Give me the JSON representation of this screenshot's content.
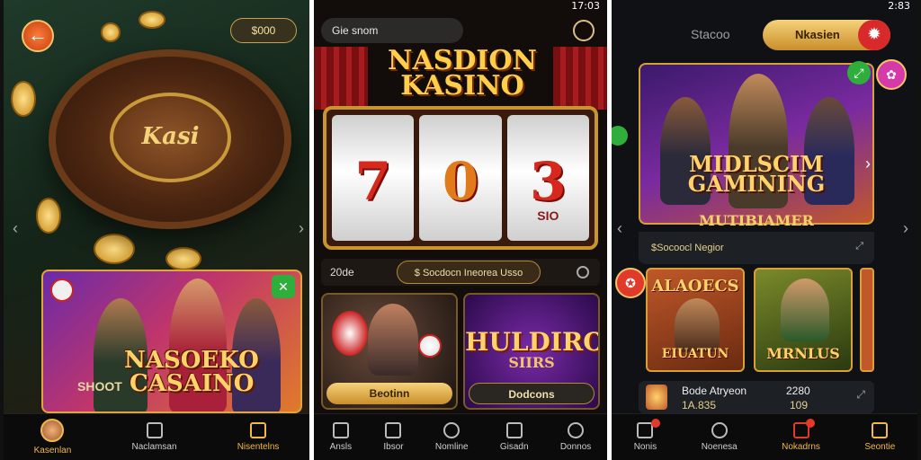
{
  "screen1": {
    "coin_balance": "$000",
    "roulette_brand": "Kasi",
    "promo_title_line1": "NASOEKO",
    "promo_title_line2": "CASAINO",
    "promo_sign": "SHOOT",
    "nav": [
      {
        "label": "Kasenlan",
        "icon": "avatar-icon",
        "active": true
      },
      {
        "label": "Naclamsan",
        "icon": "home-icon",
        "active": false
      },
      {
        "label": "Nisentelns",
        "icon": "tag-icon",
        "active": false
      }
    ]
  },
  "screen2": {
    "time": "17:03",
    "search_text": "Gie snom",
    "logo_line1": "NASDION",
    "logo_line2": "KASINO",
    "reels": [
      "7",
      "0",
      "3"
    ],
    "reel_small_labels": [
      "",
      "",
      "SIO"
    ],
    "bar_label": "20de",
    "bar_pill": "$ Socdocn Ineorea Usso",
    "tile2_title_line1": "HULDIRO",
    "tile2_title_line2": "SIIRS",
    "tile1_button": "Beotinn",
    "tile2_button": "Dodcons",
    "nav": [
      {
        "label": "Ansls",
        "icon": "shop-icon"
      },
      {
        "label": "Ibsor",
        "icon": "signal-icon"
      },
      {
        "label": "Nomline",
        "icon": "search-icon"
      },
      {
        "label": "Gisadn",
        "icon": "chat-icon"
      },
      {
        "label": "Donnos",
        "icon": "settings-icon"
      }
    ]
  },
  "screen3": {
    "time": "2:83",
    "top_label": "Stacoo",
    "top_pill": "Nkasien",
    "feature_title_line1": "MIDLSCIM",
    "feature_title_line2": "GAMINING",
    "feature_subtitle": "MUTIBIAMER",
    "info_text": "$Socoocl Negior",
    "mini1_title_top": "ALAOECS",
    "mini1_title_bottom": "EIUATUN",
    "mini2_title_bottom": "MRNLUS",
    "list_title": "Bode Atryeon",
    "list_sub": "1A.835",
    "list_value_top": "2280",
    "list_value_bottom": "109",
    "nav": [
      {
        "label": "Nonis",
        "icon": "home-icon",
        "active": false
      },
      {
        "label": "Noenesa",
        "icon": "search-icon",
        "active": false
      },
      {
        "label": "Nokadrns",
        "icon": "notification-icon",
        "active": true
      },
      {
        "label": "Seontie",
        "icon": "shield-icon",
        "active": true
      }
    ]
  },
  "colors": {
    "gold": "#f1b94a",
    "accent_red": "#e23a2a",
    "accent_green": "#2fae3c"
  }
}
